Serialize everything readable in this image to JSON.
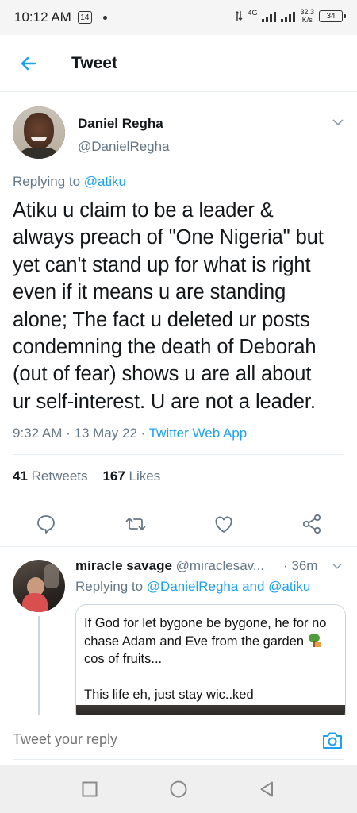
{
  "status_bar": {
    "time": "10:12 AM",
    "notification_badge": "14",
    "network_type": "4G",
    "net_speed_value": "32.3",
    "net_speed_unit": "K/s",
    "battery_level": "34"
  },
  "header": {
    "title": "Tweet"
  },
  "tweet": {
    "author_name": "Daniel Regha",
    "author_handle": "@DanielRegha",
    "replying_prefix": "Replying to",
    "replying_to": "@atiku",
    "lines": [
      "Atiku u claim to be a leader &",
      "always preach of \"One Nigeria\" but",
      "yet can't stand up for what is right",
      "even if it means u are standing",
      "alone; The fact u deleted ur posts",
      "condemning the death of Deborah",
      "(out of fear) shows u are all about",
      "ur self-interest. U are not a leader."
    ],
    "time": "9:32 AM",
    "date": "13 May 22",
    "separator": "·",
    "app": "Twitter Web App",
    "retweets_count": "41",
    "retweets_label": "Retweets",
    "likes_count": "167",
    "likes_label": "Likes"
  },
  "reply": {
    "author_name": "miracle savage",
    "author_handle": "@miraclesav...",
    "time": "· 36m",
    "replying_prefix": "Replying to",
    "replying_to": "@DanielRegha and @atiku",
    "media_lines": [
      "If God for let bygone be bygone, he for no",
      "chase Adam and Eve from the garden",
      "cos of fruits...",
      "",
      "This life eh, just stay wic..ked"
    ]
  },
  "compose": {
    "placeholder": "Tweet your reply"
  },
  "colors": {
    "accent": "#1da1f2",
    "secondary_text": "#657786",
    "border": "#e6ecf0"
  }
}
